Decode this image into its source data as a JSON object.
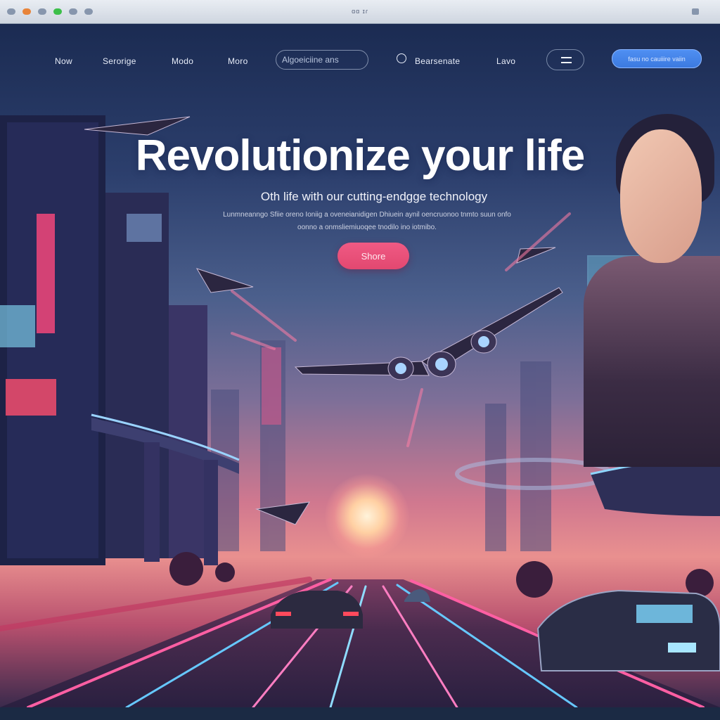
{
  "browser": {
    "title": "ɑɑ ɪɾ"
  },
  "nav": {
    "items": [
      "Now",
      "Serorige",
      "Modo",
      "Moro"
    ],
    "search_placeholder": "Algoeiciine ans",
    "icon_item": "Bearsenate",
    "plain_item": "Lavo",
    "menu_icon": "menu-icon",
    "cta_label": "fasu no cauiiire vaiin"
  },
  "hero": {
    "title": "Revolutionize your life",
    "subtitle": "Oth life with our cutting-endgge technology",
    "description": "Lunmneanngo Sfiie oreno Ioniig a oveneianidigen Dhiuein aynil oencruonoo tnmto suun onfo oonno a onmsliemiuoqee tnodilo ino iotmibo.",
    "button_label": "Shore"
  },
  "colors": {
    "accent_pink": "#e24870",
    "accent_blue": "#3c7ae0",
    "sky_top": "#1b2b52",
    "sunset": "#e9908f"
  }
}
